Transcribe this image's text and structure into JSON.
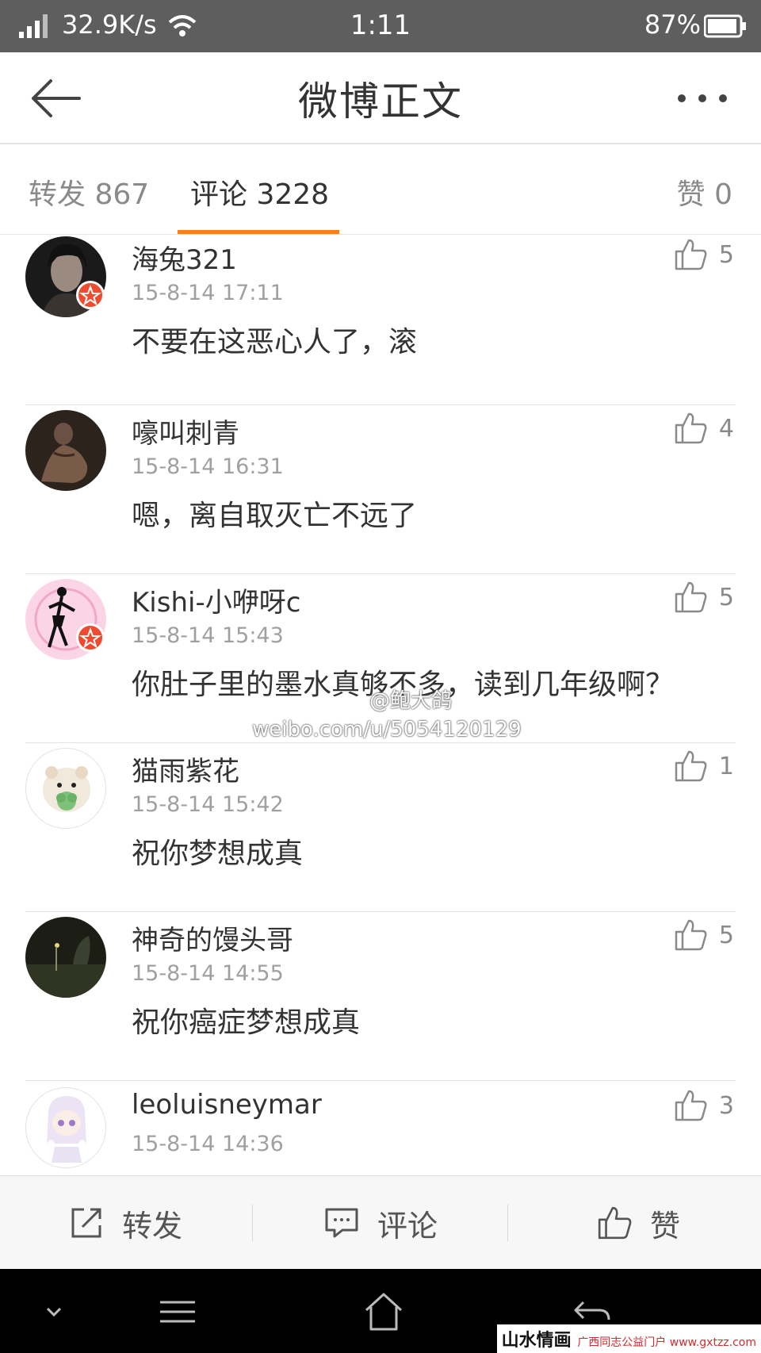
{
  "status_bar": {
    "network_speed": "32.9K/s",
    "time": "1:11",
    "battery": "87%"
  },
  "header": {
    "title": "微博正文"
  },
  "tabs": {
    "repost": "转发 867",
    "comments": "评论 3228",
    "likes": "赞 0"
  },
  "comments": [
    {
      "user": "海兔321",
      "time": "15-8-14 17:11",
      "text": "不要在这恶心人了，滚",
      "likes": "5"
    },
    {
      "user": "嚎叫刺青",
      "time": "15-8-14 16:31",
      "text": "嗯，离自取灭亡不远了",
      "likes": "4"
    },
    {
      "user": "Kishi-小咿呀c",
      "time": "15-8-14 15:43",
      "text": "你肚子里的墨水真够不多，读到几年级啊？",
      "likes": "5"
    },
    {
      "user": "猫雨紫花",
      "time": "15-8-14 15:42",
      "text": "祝你梦想成真",
      "likes": "1"
    },
    {
      "user": "神奇的馒头哥",
      "time": "15-8-14 14:55",
      "text": "祝你癌症梦想成真",
      "likes": "5"
    },
    {
      "user": "leoluisneymar",
      "time": "15-8-14 14:36",
      "text": "",
      "likes": "3"
    }
  ],
  "watermark": {
    "line1": "@鲍大鸽",
    "line2": "weibo.com/u/5054120129"
  },
  "actions": {
    "repost": "转发",
    "comment": "评论",
    "like": "赞"
  },
  "site_mark": {
    "name": "山水情画",
    "sub": "广西同志公益门户 www.gxtzz.com"
  },
  "colors": {
    "accent": "#fa7d1e",
    "status_bar": "#5e5e5e",
    "vip_badge": "#ee4b2f"
  }
}
